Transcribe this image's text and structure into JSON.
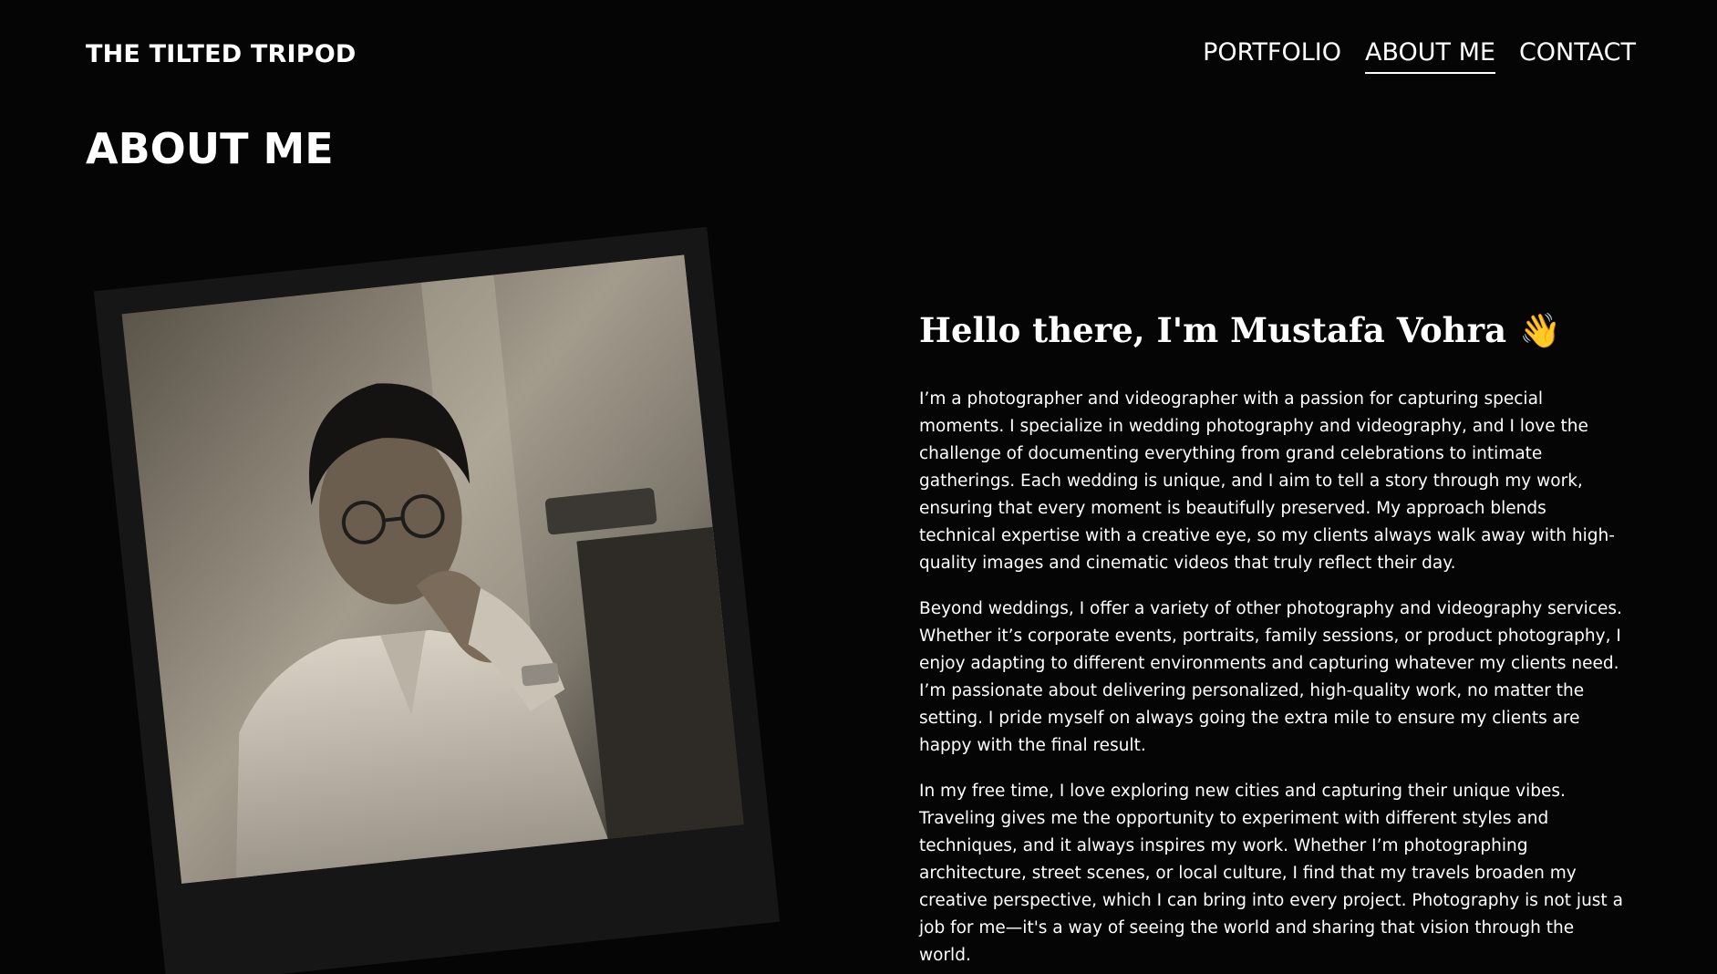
{
  "header": {
    "logo": "THE TILTED TRIPOD",
    "nav": [
      {
        "label": "PORTFOLIO",
        "active": false
      },
      {
        "label": "ABOUT ME",
        "active": true
      },
      {
        "label": "CONTACT",
        "active": false
      }
    ]
  },
  "page": {
    "title": "ABOUT ME"
  },
  "about": {
    "greeting": "Hello there, I'm Mustafa Vohra",
    "greeting_emoji": "👋",
    "paragraphs": [
      "I’m a photographer and videographer with a passion for capturing special moments. I specialize in wedding photography and videography, and I love the challenge of documenting everything from grand celebrations to intimate gatherings. Each wedding is unique, and I aim to tell a story through my work, ensuring that every moment is beautifully preserved. My approach blends technical expertise with a creative eye, so my clients always walk away with high-quality images and cinematic videos that truly reflect their day.",
      "Beyond weddings, I offer a variety of other photography and videography services. Whether it’s corporate events, portraits, family sessions, or product photography, I enjoy adapting to different environments and capturing whatever my clients need. I’m passionate about delivering personalized, high-quality work, no matter the setting. I pride myself on always going the extra mile to ensure my clients are happy with the final result.",
      "In my free time, I love exploring new cities and capturing their unique vibes. Traveling gives me the opportunity to experiment with different styles and techniques, and it always inspires my work. Whether I’m photographing architecture, street scenes, or local culture, I find that my travels broaden my creative perspective, which I can bring into every project. Photography is not just a job for me—it's a way of seeing the world and sharing that vision through the world."
    ]
  },
  "colors": {
    "background": "#050505",
    "text": "#ffffff",
    "polaroid_frame": "#161616"
  }
}
